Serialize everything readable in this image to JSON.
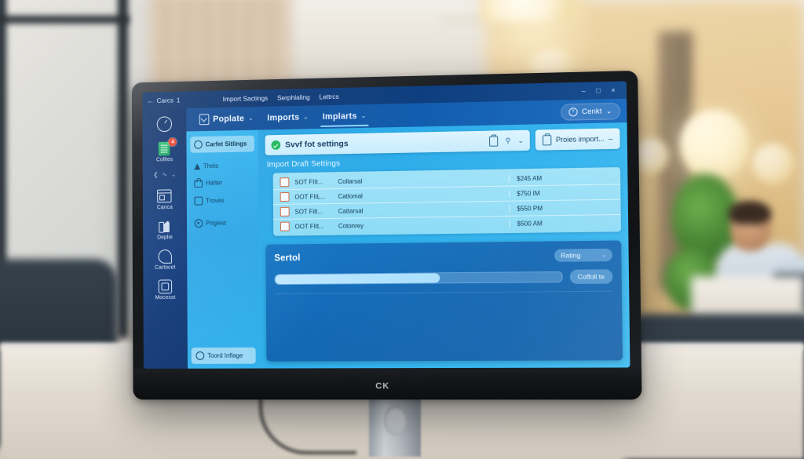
{
  "window": {
    "back_label": "Carcs",
    "back_icon": "back-arrow-icon",
    "breadcrumb_sep": "1",
    "menu_items": [
      "Import Sactings",
      "Serphlaling",
      "Lettrcs"
    ],
    "controls": {
      "minimize": "–",
      "maximize": "□",
      "close": "×"
    }
  },
  "toolbar": {
    "tabs": [
      {
        "label": "Poplate",
        "caret": "⌄",
        "icon": "page-check-icon",
        "active": false
      },
      {
        "label": "Imports",
        "caret": "⌄",
        "active": false
      },
      {
        "label": "Implarts",
        "caret": "⌄",
        "active": true
      }
    ],
    "account_button": {
      "label": "Cenkt",
      "caret": "⌄",
      "icon": "clock-icon"
    }
  },
  "rail": {
    "top_icon": "clock-icon",
    "items": [
      {
        "label": "Colltes",
        "icon": "document-icon",
        "badge": "4"
      },
      {
        "label": "Canca",
        "icon": "panel-icon",
        "badge": ""
      },
      {
        "label": "Deplie",
        "icon": "chart-icon",
        "badge": ""
      },
      {
        "label": "Cartocet",
        "icon": "loop-icon",
        "badge": ""
      },
      {
        "label": "Mocesst",
        "icon": "copy-icon",
        "badge": ""
      }
    ],
    "overflow": {
      "collapse": "❮",
      "dots": [
        "∿",
        "⌄"
      ]
    }
  },
  "subnav": {
    "items": [
      {
        "label": "Carfet Sitlings",
        "icon": "check-circle-icon",
        "selected": true
      },
      {
        "label": "Theis",
        "icon": "warning-triangle-icon",
        "selected": false
      },
      {
        "label": "Hatter",
        "icon": "lock-icon",
        "selected": false
      },
      {
        "label": "Troves",
        "icon": "square-icon",
        "selected": false
      },
      {
        "label": "Prigiest",
        "icon": "play-circle-icon",
        "selected": false
      }
    ],
    "bottom_chip": {
      "label": "Toord Inflage",
      "icon": "info-circle-icon"
    }
  },
  "main": {
    "status_bar": {
      "icon": "success-check-icon",
      "text": "Svvf fot settings",
      "actions": [
        "clipboard-icon",
        "pin-icon",
        "chevron-down-icon"
      ]
    },
    "import_button": {
      "label": "Proies import...",
      "caret": "–",
      "icon": "clipboard-icon"
    },
    "section_title": "Import Draft Settings",
    "table": {
      "rows": [
        {
          "name": "SOT FIIt...",
          "category": "Collarsal",
          "time": "$245 AM",
          "checked": false
        },
        {
          "name": "OOT FIIL...",
          "category": "Catlomal",
          "time": "$750 IM",
          "checked": false
        },
        {
          "name": "SOT Filt...",
          "category": "Cattarsal",
          "time": "$550 PM",
          "checked": false
        },
        {
          "name": "OOT FItt...",
          "category": "Cotonrey",
          "time": "$500 AM",
          "checked": false
        }
      ]
    },
    "bottom_panel": {
      "title": "Sertol",
      "select": {
        "label": "Rating",
        "caret": "⌄"
      },
      "progress_percent": 58,
      "action_button": "Coffoll te"
    }
  },
  "monitor": {
    "brand_logo": "CK"
  },
  "colors": {
    "menubar": "#0d3a79",
    "toolbar": "#125bab",
    "rail": "#103a7c",
    "page_cyan": "#2fb0ec",
    "panel_blue": "#1468b4",
    "accent_light": "#bfe8ff",
    "success_green": "#1eb85c",
    "badge_red": "#e8402f",
    "checkbox_orange": "#d4643c"
  }
}
